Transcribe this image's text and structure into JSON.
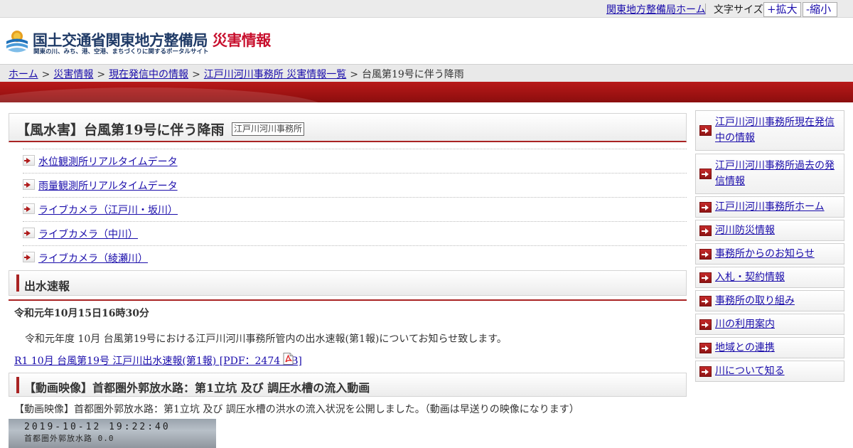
{
  "topbar": {
    "home_link": "関東地方整備局ホーム",
    "font_size_label": "文字サイズ",
    "enlarge": "+拡大",
    "shrink": "-縮小"
  },
  "header": {
    "title_main": "国土交通省関東地方整備局",
    "title_accent": "災害情報",
    "subtitle": "関東の川、みち、港、空港、まちづくりに関するポータルサイト",
    "accent_color": "#c8102e",
    "brand_color": "#1f3a66"
  },
  "breadcrumb": {
    "items": [
      "ホーム",
      "災害情報",
      "現在発信中の情報",
      "江戸川河川事務所 災害情報一覧"
    ],
    "current": "台風第19号に伴う降雨",
    "separator": ">"
  },
  "page": {
    "title": "【風水害】台風第19号に伴う降雨",
    "office_tag": "江戸川河川事務所",
    "links": [
      "水位観測所リアルタイムデータ",
      "雨量観測所リアルタイムデータ",
      "ライブカメラ（江戸川・坂川）",
      "ライブカメラ（中川）",
      "ライブカメラ（綾瀬川）"
    ]
  },
  "flood_report": {
    "heading": "出水速報",
    "date": "令和元年10月15日16時30分",
    "body": "令和元年度 10月 台風第19号における江戸川河川事務所管内の出水速報(第1報)についてお知らせ致します。",
    "pdf_link": "R1 10月 台風第19号 江戸川出水速報(第1報) [PDF：2474 KB]"
  },
  "video": {
    "heading": "【動画映像】首都圏外郭放水路：第1立坑 及び 調圧水槽の流入動画",
    "body": "【動画映像】首都圏外郭放水路：第1立坑 及び 調圧水槽の洪水の流入状況を公開しました。（動画は早送りの映像になります）",
    "thumb_timestamp": "2019-10-12 19:22:40",
    "thumb_caption": "首都圏外郭放水路 0.0"
  },
  "side_menu": [
    "江戸川河川事務所現在発信中の情報",
    "江戸川河川事務所過去の発信情報",
    "江戸川河川事務所ホーム",
    "河川防災情報",
    "事務所からのお知らせ",
    "入札・契約情報",
    "事務所の取り組み",
    "川の利用案内",
    "地域との連携",
    "川について知る"
  ],
  "icons": {
    "arrow": "arrow-right-icon",
    "pdf": "pdf-icon",
    "logo": "mlit-logo-icon"
  }
}
